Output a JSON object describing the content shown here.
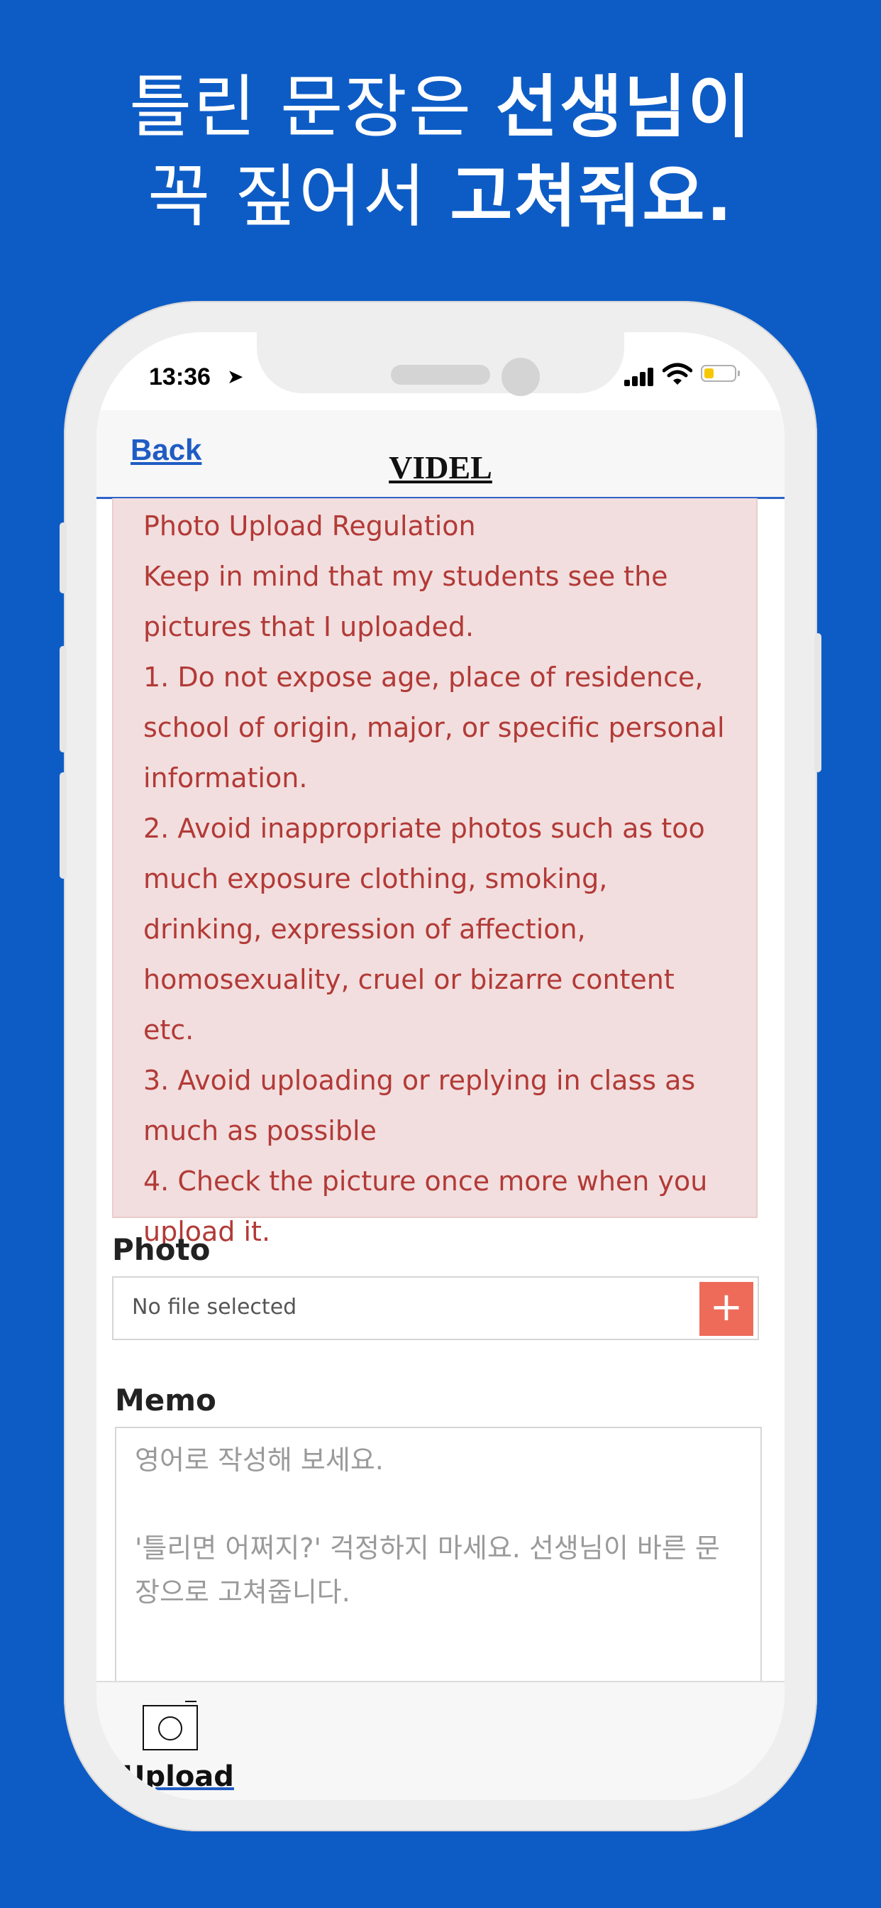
{
  "headline": {
    "line1_normal": "틀린 문장은 ",
    "line1_bold": "선생님이",
    "line2_normal": "꼭 짚어서 ",
    "line2_bold": "고쳐줘요."
  },
  "status_bar": {
    "time": "13:36",
    "location_icon": "location-arrow-icon",
    "signal_icon": "cellular-signal-icon",
    "wifi_icon": "wifi-icon",
    "battery_icon": "battery-icon",
    "battery_color": "#f5c800"
  },
  "navbar": {
    "back_label": "Back",
    "title": "VIDEL"
  },
  "regulation": {
    "lines": [
      "Photo Upload Regulation",
      "Keep in mind that my students see the pictures that I uploaded.",
      "1. Do not expose age, place of residence, school of origin, major, or specific personal information.",
      "2. Avoid inappropriate photos such as too much exposure clothing, smoking, drinking, expression of affection, homosexuality, cruel or bizarre content etc.",
      "3. Avoid uploading or replying in class as much as possible",
      "4. Check the picture once more when you upload it."
    ]
  },
  "photo": {
    "label": "Photo",
    "file_status": "No file selected",
    "add_label": "+"
  },
  "memo": {
    "label": "Memo",
    "placeholder": "영어로 작성해 보세요.\n\n'틀리면 어쩌지?' 걱정하지 마세요. 선생님이 바른 문장으로 고쳐줍니다."
  },
  "tabbar": {
    "upload_label": "Upload",
    "upload_icon": "camera-icon"
  },
  "colors": {
    "background": "#0d5cc6",
    "alert_bg": "#f2dede",
    "alert_text": "#b23a37",
    "add_button": "#ee6b5a",
    "link": "#1f5cc4"
  }
}
